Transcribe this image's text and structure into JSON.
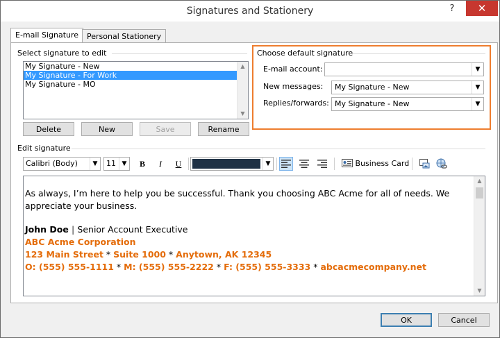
{
  "window": {
    "title": "Signatures and Stationery",
    "help_label": "?",
    "close_label": "✕"
  },
  "tabs": [
    {
      "label": "E-mail Signature",
      "active": true
    },
    {
      "label": "Personal Stationery",
      "active": false
    }
  ],
  "select_section": {
    "label": "Select signature to edit",
    "items": [
      "My Signature  - New",
      "My Signature  - For Work",
      "My Signature  - MO"
    ],
    "selected_index": 1
  },
  "list_buttons": {
    "delete": "Delete",
    "new": "New",
    "save": "Save",
    "rename": "Rename"
  },
  "default_section": {
    "label": "Choose default signature",
    "email_account_label": "E-mail account:",
    "email_account_value": "",
    "new_messages_label": "New messages:",
    "new_messages_value": "My Signature  - New",
    "replies_label": "Replies/forwards:",
    "replies_value": "My Signature  - New",
    "highlight_color": "#ee7d2e"
  },
  "edit_section": {
    "label": "Edit signature",
    "font_value": "Calibri (Body)",
    "size_value": "11",
    "bold": "B",
    "italic": "I",
    "underline": "U",
    "color_swatch": "#1f3145",
    "business_card": "Business Card",
    "icons": [
      "align-left-icon",
      "align-center-icon",
      "align-right-icon",
      "business-card-icon",
      "insert-picture-icon",
      "hyperlink-icon"
    ]
  },
  "signature": {
    "line1": "As always, I’m here to help you be successful. Thank you choosing ABC Acme for all of needs. We",
    "line2": "appreciate your business.",
    "name": "John Doe",
    "separator": "|",
    "title": "Senior Account Executive",
    "company": "ABC Acme Corporation",
    "address_street": "123 Main Street",
    "address_sep1": "*",
    "address_suite": "Suite 1000",
    "address_sep2": "*",
    "address_city": "Anytown, AK 12345",
    "phone_o": "O: (555) 555-1111",
    "sep_a": "*",
    "phone_m": "M: (555) 555-2222",
    "sep_b": "*",
    "phone_f": "F: (555) 555-3333",
    "sep_c": "*",
    "website": "abcacmecompany.net",
    "accent_color": "#e46c0a"
  },
  "footer": {
    "ok": "OK",
    "cancel": "Cancel"
  }
}
